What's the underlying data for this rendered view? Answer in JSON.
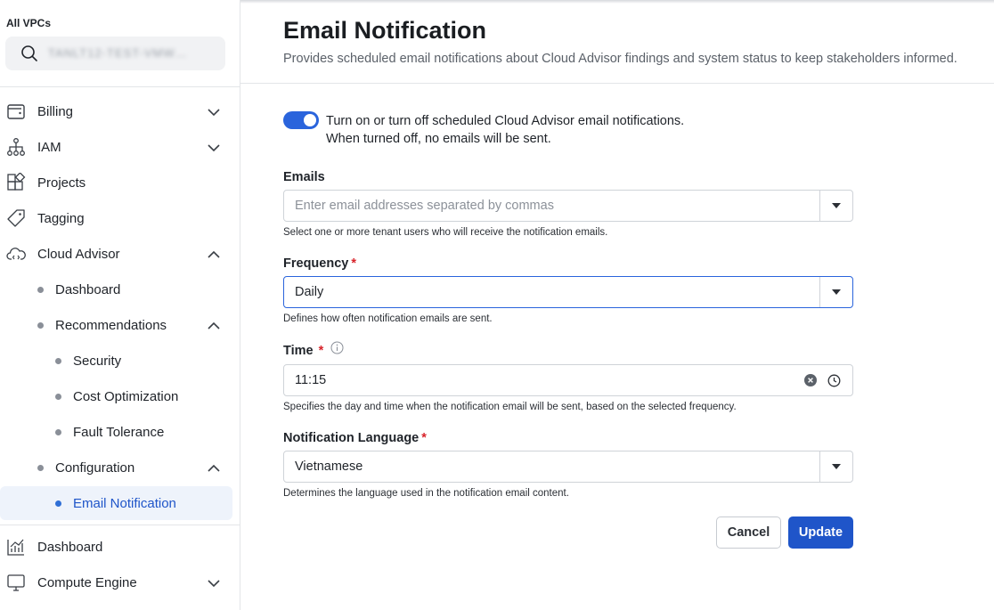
{
  "sidebar": {
    "vpc_label": "All VPCs",
    "search_value": "TANLT12-TEST-VMW…",
    "items": [
      {
        "label": "Billing",
        "icon": "wallet-icon",
        "chevron": "down"
      },
      {
        "label": "IAM",
        "icon": "org-tree-icon",
        "chevron": "down"
      },
      {
        "label": "Projects",
        "icon": "projects-icon"
      },
      {
        "label": "Tagging",
        "icon": "tag-icon"
      },
      {
        "label": "Cloud Advisor",
        "icon": "cloud-code-icon",
        "chevron": "up"
      },
      {
        "label": "Dashboard"
      },
      {
        "label": "Recommendations",
        "chevron": "up"
      },
      {
        "label": "Security"
      },
      {
        "label": "Cost Optimization"
      },
      {
        "label": "Fault Tolerance"
      },
      {
        "label": "Configuration",
        "chevron": "up"
      },
      {
        "label": "Email Notification",
        "active": true
      },
      {
        "label": "Dashboard",
        "icon": "chart-icon"
      },
      {
        "label": "Compute Engine",
        "icon": "monitor-icon",
        "chevron": "down"
      }
    ]
  },
  "main": {
    "title": "Email Notification",
    "subtitle": "Provides scheduled email notifications about Cloud Advisor findings and system status to keep stakeholders informed.",
    "toggle": {
      "on": true,
      "line1": "Turn on or turn off scheduled Cloud Advisor email notifications.",
      "line2": "When turned off, no emails will be sent."
    },
    "emails": {
      "label": "Emails",
      "placeholder": "Enter email addresses separated by commas",
      "help": "Select one or more tenant users who will receive the notification emails."
    },
    "frequency": {
      "label": "Frequency",
      "required": "*",
      "value": "Daily",
      "help": "Defines how often notification emails are sent."
    },
    "time": {
      "label": "Time",
      "required": "*",
      "value": "11:15",
      "help": "Specifies the day and time when the notification email will be sent, based on the selected frequency."
    },
    "language": {
      "label": "Notification Language",
      "required": "*",
      "value": "Vietnamese",
      "help": "Determines the language used in the notification email content."
    },
    "buttons": {
      "cancel": "Cancel",
      "update": "Update"
    }
  },
  "colors": {
    "accent": "#1f55c9",
    "toggle": "#2a64dc",
    "required": "#d8232a",
    "active_bg": "#eef3fb"
  }
}
